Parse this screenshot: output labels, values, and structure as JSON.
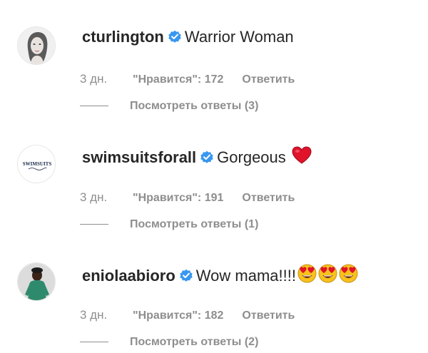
{
  "comments": [
    {
      "username": "cturlington",
      "text": "Warrior Woman",
      "time": "3 дн.",
      "likes": "\"Нравится\": 172",
      "reply": "Ответить",
      "view_replies": "Посмотреть ответы (3)",
      "verified": true,
      "avatar_icon": "woman-portrait-avatar"
    },
    {
      "username": "swimsuitsforall",
      "text": "Gorgeous",
      "time": "3 дн.",
      "likes": "\"Нравится\": 191",
      "reply": "Ответить",
      "view_replies": "Посмотреть ответы (1)",
      "verified": true,
      "avatar_icon": "swimsuits-logo-avatar",
      "avatar_logo_text": "SWIMSUITS",
      "emoji": [
        "red-heart"
      ]
    },
    {
      "username": "eniolaabioro",
      "text": "Wow mama!!!!",
      "time": "3 дн.",
      "likes": "\"Нравится\": 182",
      "reply": "Ответить",
      "view_replies": "Посмотреть ответы (2)",
      "verified": true,
      "avatar_icon": "woman-green-outfit-avatar",
      "emoji": [
        "heart-eyes-face",
        "heart-eyes-face",
        "heart-eyes-face"
      ]
    }
  ],
  "colors": {
    "verified_blue": "#3897f0",
    "meta_gray": "#8e8e8e",
    "text_dark": "#262626",
    "heart_red": "#e0132b",
    "emoji_yellow": "#f7c21c"
  }
}
